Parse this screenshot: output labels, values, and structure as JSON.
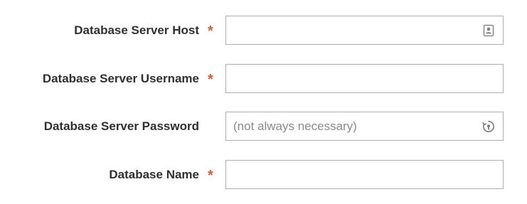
{
  "form": {
    "fields": [
      {
        "label": "Database Server Host",
        "required_marker": "*",
        "value": "",
        "placeholder": "",
        "icon": "contact-card-icon"
      },
      {
        "label": "Database Server Username",
        "required_marker": "*",
        "value": "",
        "placeholder": ""
      },
      {
        "label": "Database Server Password",
        "required_marker": "",
        "value": "",
        "placeholder": "(not always necessary)",
        "icon": "password-manager-icon"
      },
      {
        "label": "Database Name",
        "required_marker": "*",
        "value": "",
        "placeholder": ""
      }
    ]
  },
  "colors": {
    "required_marker": "#e0592a",
    "label_text": "#303030",
    "field_border": "#adadad",
    "placeholder_text": "#8a8a8a"
  }
}
